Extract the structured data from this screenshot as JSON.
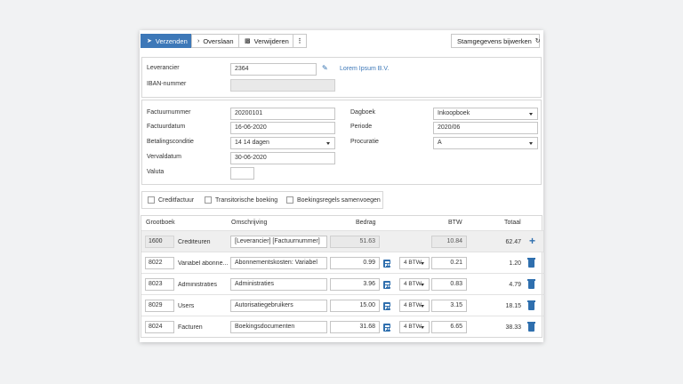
{
  "toolbar": {
    "send_label": "Verzenden",
    "skip_label": "Overslaan",
    "delete_label": "Verwijderen",
    "update_master_label": "Stamgegevens bijwerken"
  },
  "supplier": {
    "leverancier_label": "Leverancier",
    "leverancier_value": "2364",
    "supplier_name": "Lorem Ipsum B.V.",
    "iban_label": "IBAN-nummer",
    "iban_value": ""
  },
  "invoice": {
    "factuurnummer_label": "Factuurnummer",
    "factuurnummer_value": "20200101",
    "factuurdatum_label": "Factuurdatum",
    "factuurdatum_value": "16-06-2020",
    "betalingsconditie_label": "Betalingsconditie",
    "betalingsconditie_value": "14 14 dagen",
    "vervaldatum_label": "Vervaldatum",
    "vervaldatum_value": "30-06-2020",
    "valuta_label": "Valuta",
    "valuta_value": "",
    "dagboek_label": "Dagboek",
    "dagboek_value": "Inkoopboek",
    "periode_label": "Periode",
    "periode_value": "2020/06",
    "procuratie_label": "Procuratie",
    "procuratie_value": "A"
  },
  "options": {
    "creditfactuur": "Creditfactuur",
    "transitorische": "Transitorische boeking",
    "samenvoegen": "Boekingsregels samenvoegen"
  },
  "table": {
    "headers": {
      "grootboek": "Grootboek",
      "omschrijving": "Omschrijving",
      "bedrag": "Bedrag",
      "btw": "BTW",
      "totaal": "Totaal"
    },
    "rows": [
      {
        "code": "1600",
        "name": "Crediteuren",
        "description": "[Leverancier] [Factuurnummer]",
        "amount": "51.63",
        "vat_code": "",
        "vat": "10.84",
        "total": "62.47"
      },
      {
        "code": "8022",
        "name": "Variabel abonne...",
        "description": "Abonnementskosten: Variabel",
        "amount": "0.99",
        "vat_code": "4 BTW",
        "vat": "0.21",
        "total": "1.20"
      },
      {
        "code": "8023",
        "name": "Administraties",
        "description": "Administraties",
        "amount": "3.96",
        "vat_code": "4 BTW",
        "vat": "0.83",
        "total": "4.79"
      },
      {
        "code": "8029",
        "name": "Users",
        "description": "Autorisatiegebruikers",
        "amount": "15.00",
        "vat_code": "4 BTW",
        "vat": "3.15",
        "total": "18.15"
      },
      {
        "code": "8024",
        "name": "Facturen",
        "description": "Boekingsdocumenten",
        "amount": "31.68",
        "vat_code": "4 BTW",
        "vat": "6.65",
        "total": "38.33"
      }
    ]
  },
  "colors": {
    "primary": "#3d78b8",
    "icon": "#2f6fae",
    "background": "#f1f2f3"
  }
}
